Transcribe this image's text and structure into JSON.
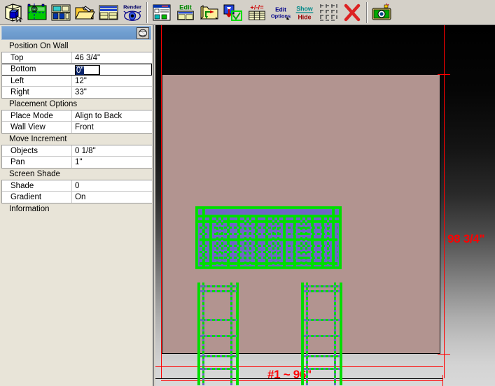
{
  "toolbar": {
    "buttons": [
      {
        "name": "room-3d-view-icon",
        "label": ""
      },
      {
        "name": "floor-plan-icon",
        "label": ""
      },
      {
        "name": "elevation-view-icon",
        "label": ""
      },
      {
        "name": "open-folder-icon",
        "label": ""
      },
      {
        "name": "cabinet-library-icon",
        "label": ""
      },
      {
        "name": "render-icon",
        "label": "Render"
      },
      {
        "name": "report-icon",
        "label": ""
      },
      {
        "name": "edit-icon",
        "label": "Edit"
      },
      {
        "name": "edit-folder-icon",
        "label": ""
      },
      {
        "name": "approve-check-icon",
        "label": ""
      },
      {
        "name": "plus-minus-equal-icon",
        "label": "+/-/="
      },
      {
        "name": "edit-options-icon",
        "label": "Edit Options"
      },
      {
        "name": "show-hide-icon",
        "label": "Show Hide"
      },
      {
        "name": "grid-icon",
        "label": ""
      },
      {
        "name": "delete-icon",
        "label": ""
      },
      {
        "name": "camera-icon",
        "label": ""
      }
    ]
  },
  "panel": {
    "title": "",
    "globe_button_name": "view-sphere-button",
    "groups": [
      {
        "header": "Position On Wall",
        "rows": [
          {
            "name": "Top",
            "value": "46 3/4\"",
            "editing": false
          },
          {
            "name": "Bottom",
            "value": "0\"",
            "editing": true
          },
          {
            "name": "Left",
            "value": "12\"",
            "editing": false
          },
          {
            "name": "Right",
            "value": "33\"",
            "editing": false
          }
        ]
      },
      {
        "header": "Placement Options",
        "rows": [
          {
            "name": "Place Mode",
            "value": "Align to Back",
            "editing": false
          },
          {
            "name": "Wall View",
            "value": "Front",
            "editing": false
          }
        ]
      },
      {
        "header": "Move Increment",
        "rows": [
          {
            "name": "Objects",
            "value": "0 1/8\"",
            "editing": false
          },
          {
            "name": "Pan",
            "value": "1\"",
            "editing": false
          }
        ]
      },
      {
        "header": "Screen Shade",
        "rows": [
          {
            "name": "Shade",
            "value": "0",
            "editing": false
          },
          {
            "name": "Gradient",
            "value": "On",
            "editing": false
          }
        ]
      },
      {
        "header": "Information",
        "rows": []
      }
    ]
  },
  "viewport": {
    "wall_color": "#b29490",
    "wireframe_color": "#00dd00",
    "panel_fill_color": "#6f66c4",
    "dimension_color": "#ff0000",
    "height_dimension": "98 3/4\"",
    "width_dimension": "#1 ~ 96\""
  }
}
